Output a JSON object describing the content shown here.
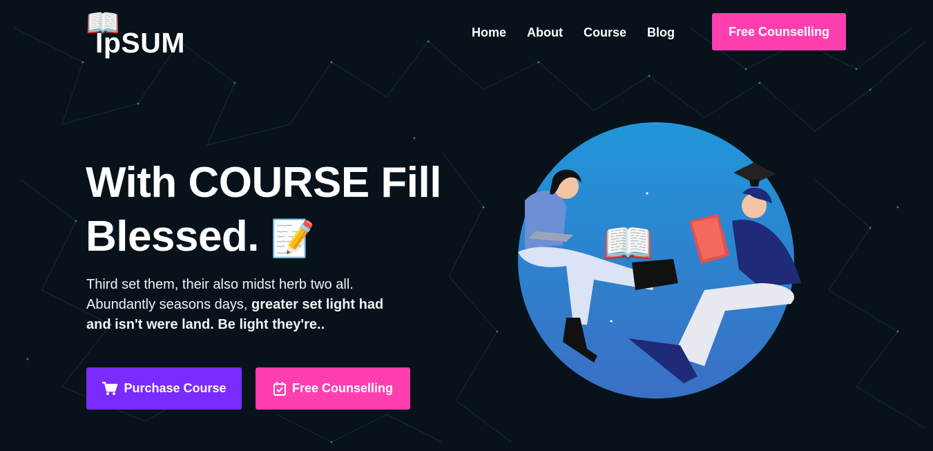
{
  "brand": {
    "name": "IpSUM",
    "logo_icon": "open-book-icon"
  },
  "nav": {
    "items": [
      {
        "label": "Home"
      },
      {
        "label": "About"
      },
      {
        "label": "Course"
      },
      {
        "label": "Blog"
      }
    ],
    "cta_label": "Free Counselling"
  },
  "hero": {
    "title_line1": "With COURSE Fill",
    "title_line2": "Blessed.",
    "title_emoji": "📝",
    "description_plain": "Third set them, their also midst herb two all. Abundantly seasons days, ",
    "description_bold": "greater set light had and isn't were land. Be light they're..",
    "buttons": {
      "purchase_label": "Purchase Course",
      "purchase_icon": "cart-icon",
      "free_label": "Free Counselling",
      "free_icon": "calendar-check-icon"
    }
  },
  "colors": {
    "background": "#07121b",
    "pink": "#ff3fb0",
    "purple": "#7a2bff",
    "circle_blue": "#1f8bd0"
  }
}
